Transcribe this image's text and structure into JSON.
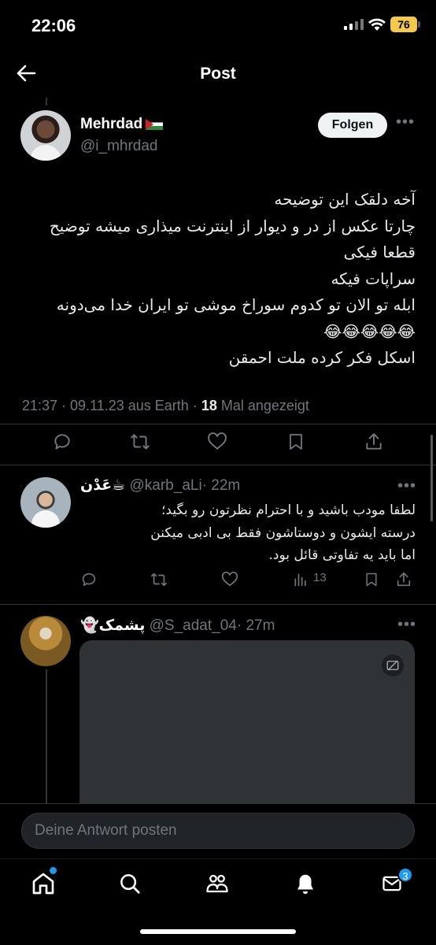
{
  "status_bar": {
    "time": "22:06",
    "battery": "76"
  },
  "header": {
    "title": "Post"
  },
  "main_tweet": {
    "author_name": "Mehrdad",
    "author_handle": "@i_mhrdad",
    "follow_label": "Folgen",
    "lines": [
      "آخه دلقک این توضیحه",
      "چارتا عکس از در و دیوار از اینترنت میذاری میشه توضیح",
      "قطعا فیکی",
      "سراپات فیکه",
      "ابله تو الان تو کدوم سوراخ موشی تو ایران خدا می‌دونه",
      "😂😂😂😂😂",
      "اسکل فکر کرده ملت احمقن"
    ],
    "timestamp": "21:37 · 09.11.23 aus Earth · ",
    "views_count": "18",
    "views_label": " Mal angezeigt"
  },
  "reply_1": {
    "name": "عَدْن☕",
    "handle": "@karb_aLi",
    "time": "· 22m",
    "lines": [
      "لطفا مودب باشید و با احترام نظرتون رو بگید؛",
      "درسته ایشون و دوستاشون فقط بی ادبی میکنن",
      "اما باید یه تفاوتی قائل بود."
    ],
    "views": "13"
  },
  "reply_2": {
    "name": "👻پشمک",
    "handle": "@S_adat_04",
    "time": "· 27m"
  },
  "reply_box": {
    "placeholder": "Deine Antwort posten"
  },
  "tab_bar": {
    "items": [
      "home-icon",
      "search-icon",
      "communities-icon",
      "notifications-icon",
      "messages-icon"
    ],
    "messages_badge": "3"
  },
  "colors": {
    "accent": "#1d9bf0",
    "background": "#000000",
    "secondary_text": "#71767b",
    "battery": "#f2c94c"
  }
}
